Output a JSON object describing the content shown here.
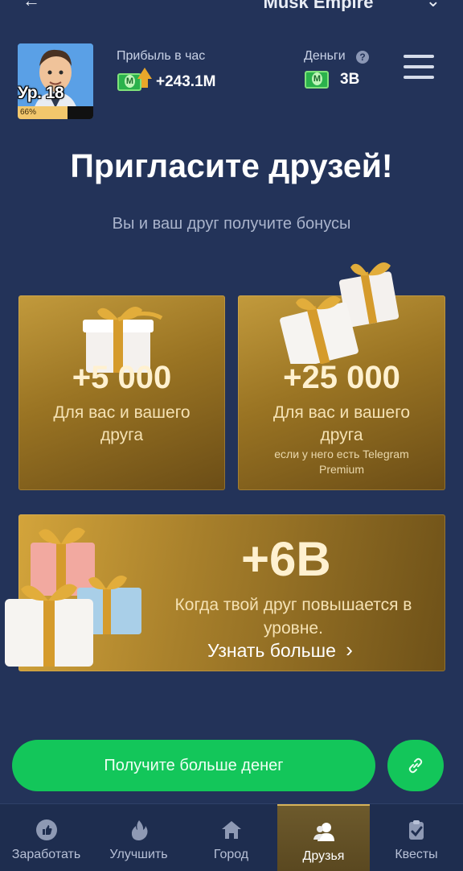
{
  "app": {
    "title": "Musk Empire",
    "left_glyph": "←",
    "right_glyph": "⌄"
  },
  "profile": {
    "level_label": "Ур. 18",
    "level_progress_text": "66%",
    "level_progress": 0.66
  },
  "stats": {
    "profit_label": "Прибыль в час",
    "profit_value": "+243.1M",
    "money_label": "Деньги",
    "money_help": "?",
    "money_value": "3B"
  },
  "main": {
    "title": "Пригласите друзей!",
    "subtitle": "Вы и ваш друг получите бонусы",
    "cards": [
      {
        "amount": "+5 000",
        "desc": "Для вас и вашего друга"
      },
      {
        "amount": "+25 000",
        "desc": "Для вас и вашего друга",
        "note": "если у него есть Telegram Premium"
      }
    ],
    "level_bonus": {
      "amount": "+6B",
      "desc": "Когда твой друг повышается в уровне.",
      "learn_more": "Узнать больше",
      "learn_more_chevron": "›"
    }
  },
  "actions": {
    "cta_label": "Получите больше денег"
  },
  "nav": {
    "items": [
      {
        "label": "Заработать",
        "icon": "thumbs-up-icon"
      },
      {
        "label": "Улучшить",
        "icon": "flame-icon"
      },
      {
        "label": "Город",
        "icon": "home-icon"
      },
      {
        "label": "Друзья",
        "icon": "friends-icon"
      },
      {
        "label": "Квесты",
        "icon": "clipboard-check-icon"
      }
    ],
    "active_index": 3
  },
  "colors": {
    "background": "#233359",
    "accent_green": "#13c65a",
    "gold": "#c29a3c"
  }
}
